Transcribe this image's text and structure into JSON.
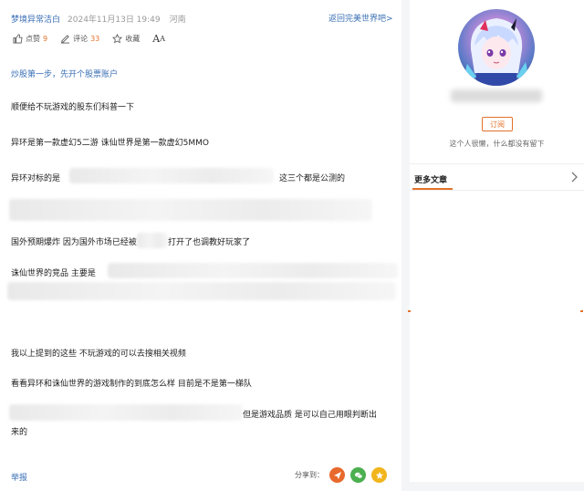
{
  "article": {
    "author": "梦境异常洁白",
    "date": "2024年11月13日 19:49",
    "location": "河南",
    "back_link": "返回完美世界吧>",
    "actions": {
      "like_label": "点赞",
      "like_count": "9",
      "comment_label": "评论",
      "comment_count": "33",
      "favorite_label": "收藏",
      "font_big": "A",
      "font_small": "A"
    },
    "lead_link": "炒股第一步，先开个股票账户",
    "paragraphs": {
      "p1": "顺便给不玩游戏的股东们科普一下",
      "p2": "异环是第一款虚幻5二游 诛仙世界是第一款虚幻5MMO",
      "p3_start": "异环对标的是",
      "p3_end": "这三个都是公测的",
      "p4_start": "国外预期爆炸 因为国外市场已经被",
      "p4_end": "打开了也调教好玩家了",
      "p5": "诛仙世界的竞品  主要是",
      "p6": "我以上提到的这些 不玩游戏的可以去搜相关视频",
      "p7": "看看异环和诛仙世界的游戏制作的到底怎么样 目前是不是第一梯队",
      "p8_end": "但是游戏品质  是可以自己用眼判断出",
      "p8_cont": "来的"
    },
    "report_label": "举报",
    "share_label": "分享到："
  },
  "sidebar": {
    "subscribe_label": "订阅",
    "bio": "这个人很懒，什么都没有留下",
    "more_articles_tab": "更多文章"
  },
  "colors": {
    "link": "#3a6fb5",
    "accent": "#e3722a",
    "share_1": "#e8692c",
    "share_2": "#4caf50",
    "share_3": "#f1b51c"
  }
}
